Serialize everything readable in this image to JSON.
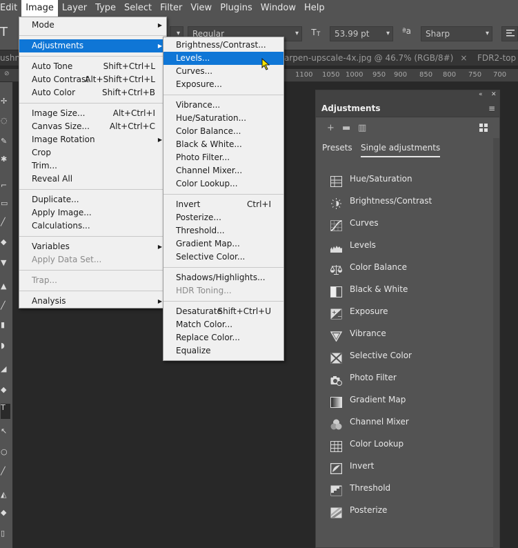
{
  "menubar": {
    "items": [
      "Edit",
      "Image",
      "Layer",
      "Type",
      "Select",
      "Filter",
      "View",
      "Plugins",
      "Window",
      "Help"
    ],
    "active": "Image"
  },
  "options_bar": {
    "font_style": "Regular",
    "font_size": "53.99 pt",
    "antialias": "Sharp",
    "font_size_icon": "font-size-icon",
    "antialias_icon": "antialias-icon"
  },
  "tabs": {
    "left_partial": "ushn",
    "current": "arpen-upscale-4x.jpg @ 46.7% (RGB/8#)",
    "next": "FDR2-top"
  },
  "ruler": {
    "numbers": [
      "1100",
      "1050",
      "1000",
      "950",
      "900",
      "850",
      "800",
      "750",
      "700"
    ]
  },
  "image_menu": {
    "items": [
      {
        "label": "Mode",
        "shortcut": "",
        "submenu": true,
        "disabled": false,
        "selected": false
      },
      {
        "sep": true
      },
      {
        "label": "Adjustments",
        "shortcut": "",
        "submenu": true,
        "disabled": false,
        "selected": true
      },
      {
        "sep": true
      },
      {
        "label": "Auto Tone",
        "shortcut": "Shift+Ctrl+L",
        "submenu": false,
        "disabled": false,
        "selected": false
      },
      {
        "label": "Auto Contrast",
        "shortcut": "Alt+Shift+Ctrl+L",
        "submenu": false,
        "disabled": false,
        "selected": false
      },
      {
        "label": "Auto Color",
        "shortcut": "Shift+Ctrl+B",
        "submenu": false,
        "disabled": false,
        "selected": false
      },
      {
        "sep": true
      },
      {
        "label": "Image Size...",
        "shortcut": "Alt+Ctrl+I",
        "submenu": false,
        "disabled": false,
        "selected": false
      },
      {
        "label": "Canvas Size...",
        "shortcut": "Alt+Ctrl+C",
        "submenu": false,
        "disabled": false,
        "selected": false
      },
      {
        "label": "Image Rotation",
        "shortcut": "",
        "submenu": true,
        "disabled": false,
        "selected": false
      },
      {
        "label": "Crop",
        "shortcut": "",
        "submenu": false,
        "disabled": false,
        "selected": false
      },
      {
        "label": "Trim...",
        "shortcut": "",
        "submenu": false,
        "disabled": false,
        "selected": false
      },
      {
        "label": "Reveal All",
        "shortcut": "",
        "submenu": false,
        "disabled": false,
        "selected": false
      },
      {
        "sep": true
      },
      {
        "label": "Duplicate...",
        "shortcut": "",
        "submenu": false,
        "disabled": false,
        "selected": false
      },
      {
        "label": "Apply Image...",
        "shortcut": "",
        "submenu": false,
        "disabled": false,
        "selected": false
      },
      {
        "label": "Calculations...",
        "shortcut": "",
        "submenu": false,
        "disabled": false,
        "selected": false
      },
      {
        "sep": true
      },
      {
        "label": "Variables",
        "shortcut": "",
        "submenu": true,
        "disabled": false,
        "selected": false
      },
      {
        "label": "Apply Data Set...",
        "shortcut": "",
        "submenu": false,
        "disabled": true,
        "selected": false
      },
      {
        "sep": true
      },
      {
        "label": "Trap...",
        "shortcut": "",
        "submenu": false,
        "disabled": true,
        "selected": false
      },
      {
        "sep": true
      },
      {
        "label": "Analysis",
        "shortcut": "",
        "submenu": true,
        "disabled": false,
        "selected": false
      }
    ]
  },
  "adjustments_menu": {
    "items": [
      {
        "label": "Brightness/Contrast...",
        "shortcut": "",
        "disabled": false,
        "selected": false
      },
      {
        "label": "Levels...",
        "shortcut": "",
        "disabled": false,
        "selected": true
      },
      {
        "label": "Curves...",
        "shortcut": "",
        "disabled": false,
        "selected": false
      },
      {
        "label": "Exposure...",
        "shortcut": "",
        "disabled": false,
        "selected": false
      },
      {
        "sep": true
      },
      {
        "label": "Vibrance...",
        "shortcut": "",
        "disabled": false,
        "selected": false
      },
      {
        "label": "Hue/Saturation...",
        "shortcut": "",
        "disabled": false,
        "selected": false
      },
      {
        "label": "Color Balance...",
        "shortcut": "",
        "disabled": false,
        "selected": false
      },
      {
        "label": "Black & White...",
        "shortcut": "",
        "disabled": false,
        "selected": false
      },
      {
        "label": "Photo Filter...",
        "shortcut": "",
        "disabled": false,
        "selected": false
      },
      {
        "label": "Channel Mixer...",
        "shortcut": "",
        "disabled": false,
        "selected": false
      },
      {
        "label": "Color Lookup...",
        "shortcut": "",
        "disabled": false,
        "selected": false
      },
      {
        "sep": true
      },
      {
        "label": "Invert",
        "shortcut": "Ctrl+I",
        "disabled": false,
        "selected": false
      },
      {
        "label": "Posterize...",
        "shortcut": "",
        "disabled": false,
        "selected": false
      },
      {
        "label": "Threshold...",
        "shortcut": "",
        "disabled": false,
        "selected": false
      },
      {
        "label": "Gradient Map...",
        "shortcut": "",
        "disabled": false,
        "selected": false
      },
      {
        "label": "Selective Color...",
        "shortcut": "",
        "disabled": false,
        "selected": false
      },
      {
        "sep": true
      },
      {
        "label": "Shadows/Highlights...",
        "shortcut": "",
        "disabled": false,
        "selected": false
      },
      {
        "label": "HDR Toning...",
        "shortcut": "",
        "disabled": true,
        "selected": false
      },
      {
        "sep": true
      },
      {
        "label": "Desaturate",
        "shortcut": "Shift+Ctrl+U",
        "disabled": false,
        "selected": false
      },
      {
        "label": "Match Color...",
        "shortcut": "",
        "disabled": false,
        "selected": false
      },
      {
        "label": "Replace Color...",
        "shortcut": "",
        "disabled": false,
        "selected": false
      },
      {
        "label": "Equalize",
        "shortcut": "",
        "disabled": false,
        "selected": false
      }
    ]
  },
  "adjustments_panel": {
    "title": "Adjustments",
    "tabs": [
      "Presets",
      "Single adjustments"
    ],
    "active_tab": "Single adjustments",
    "items": [
      {
        "label": "Hue/Saturation",
        "icon": "hue-saturation-icon"
      },
      {
        "label": "Brightness/Contrast",
        "icon": "brightness-contrast-icon"
      },
      {
        "label": "Curves",
        "icon": "curves-icon"
      },
      {
        "label": "Levels",
        "icon": "levels-icon"
      },
      {
        "label": "Color Balance",
        "icon": "color-balance-icon"
      },
      {
        "label": "Black & White",
        "icon": "black-white-icon"
      },
      {
        "label": "Exposure",
        "icon": "exposure-icon"
      },
      {
        "label": "Vibrance",
        "icon": "vibrance-icon"
      },
      {
        "label": "Selective Color",
        "icon": "selective-color-icon"
      },
      {
        "label": "Photo Filter",
        "icon": "photo-filter-icon"
      },
      {
        "label": "Gradient Map",
        "icon": "gradient-map-icon"
      },
      {
        "label": "Channel Mixer",
        "icon": "channel-mixer-icon"
      },
      {
        "label": "Color Lookup",
        "icon": "color-lookup-icon"
      },
      {
        "label": "Invert",
        "icon": "invert-icon"
      },
      {
        "label": "Threshold",
        "icon": "threshold-icon"
      },
      {
        "label": "Posterize",
        "icon": "posterize-icon"
      }
    ]
  },
  "colors": {
    "menu_highlight": "#0f76d6",
    "app_bar": "#535353",
    "canvas_bg": "#282828"
  }
}
